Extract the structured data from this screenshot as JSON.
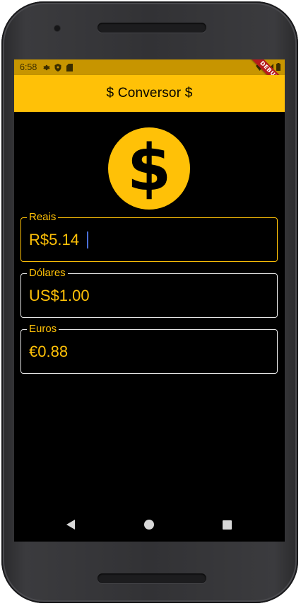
{
  "status_bar": {
    "time": "6:58",
    "icons_left": [
      "settings-icon",
      "shield-icon",
      "sd-card-icon"
    ],
    "icons_right": [
      "wifi-icon",
      "signal-icon",
      "battery-icon"
    ],
    "debug_banner": "DEBUG"
  },
  "app_bar": {
    "title": "$ Conversor $"
  },
  "logo": {
    "icon": "dollar-circle-icon",
    "glyph": "$",
    "color": "#ffc107"
  },
  "fields": [
    {
      "label": "Reais",
      "value": "R$5.14",
      "focused": true
    },
    {
      "label": "Dólares",
      "value": "US$1.00",
      "focused": false
    },
    {
      "label": "Euros",
      "value": "€0.88",
      "focused": false
    }
  ],
  "nav_bar": {
    "buttons": [
      "back-icon",
      "home-icon",
      "recents-icon"
    ]
  },
  "colors": {
    "accent": "#ffc107",
    "status_bar": "#c79500",
    "background": "#000000",
    "caret": "#4a6fd8"
  }
}
